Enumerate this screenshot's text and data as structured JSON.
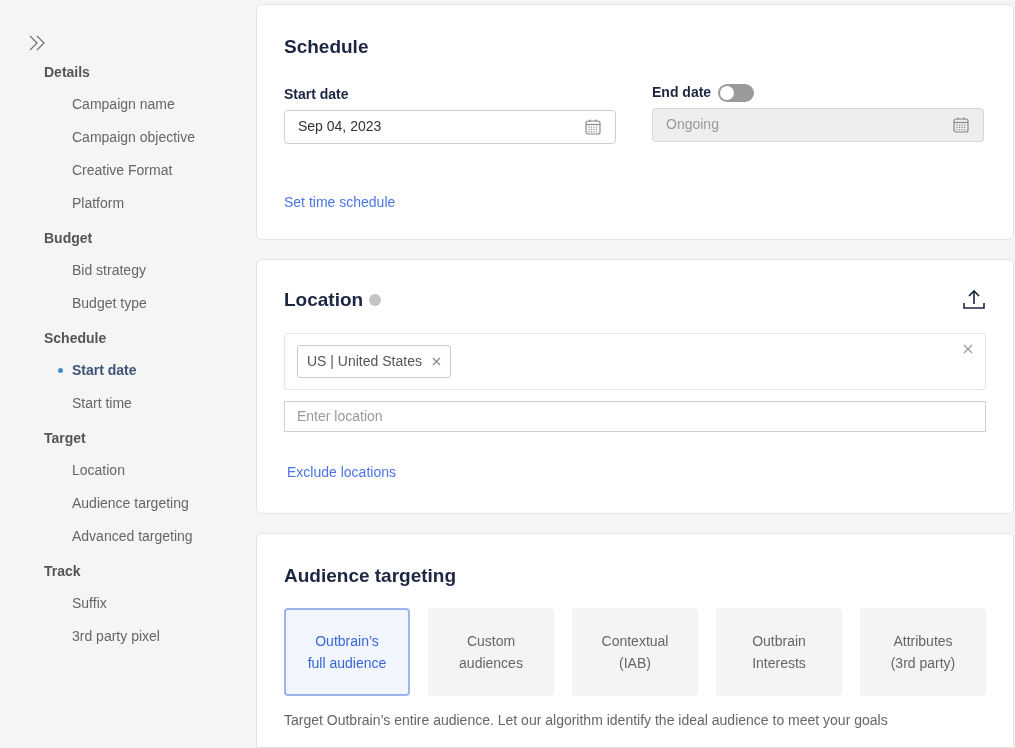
{
  "sidebar": {
    "sections": [
      {
        "title": "Details",
        "items": [
          {
            "label": "Campaign name",
            "selected": false
          },
          {
            "label": "Campaign objective",
            "selected": false
          },
          {
            "label": "Creative Format",
            "selected": false
          },
          {
            "label": "Platform",
            "selected": false
          }
        ]
      },
      {
        "title": "Budget",
        "items": [
          {
            "label": "Bid strategy",
            "selected": false
          },
          {
            "label": "Budget type",
            "selected": false
          }
        ]
      },
      {
        "title": "Schedule",
        "items": [
          {
            "label": "Start date",
            "selected": true
          },
          {
            "label": "Start time",
            "selected": false
          }
        ]
      },
      {
        "title": "Target",
        "items": [
          {
            "label": "Location",
            "selected": false
          },
          {
            "label": "Audience targeting",
            "selected": false
          },
          {
            "label": "Advanced targeting",
            "selected": false
          }
        ]
      },
      {
        "title": "Track",
        "items": [
          {
            "label": "Suffix",
            "selected": false
          },
          {
            "label": "3rd party pixel",
            "selected": false
          }
        ]
      }
    ]
  },
  "schedule": {
    "title": "Schedule",
    "start_date": {
      "label": "Start date",
      "value": "Sep 04, 2023"
    },
    "end_date": {
      "label": "End date",
      "on": false,
      "value": "Ongoing",
      "disabled": true
    },
    "link": "Set time schedule"
  },
  "location": {
    "title": "Location",
    "tags": [
      "US | United States"
    ],
    "placeholder": "Enter location",
    "link": "Exclude locations"
  },
  "audience": {
    "title": "Audience targeting",
    "options": [
      {
        "lines": [
          "Outbrain’s",
          "full audience"
        ],
        "selected": true
      },
      {
        "lines": [
          "Custom",
          "audiences"
        ],
        "selected": false
      },
      {
        "lines": [
          "Contextual",
          "(IAB)"
        ],
        "selected": false
      },
      {
        "lines": [
          "Outbrain",
          "Interests"
        ],
        "selected": false
      },
      {
        "lines": [
          "Attributes",
          "(3rd party)"
        ],
        "selected": false
      }
    ],
    "description": "Target Outbrain’s entire audience. Let our algorithm identify the ideal audience to meet your goals"
  }
}
